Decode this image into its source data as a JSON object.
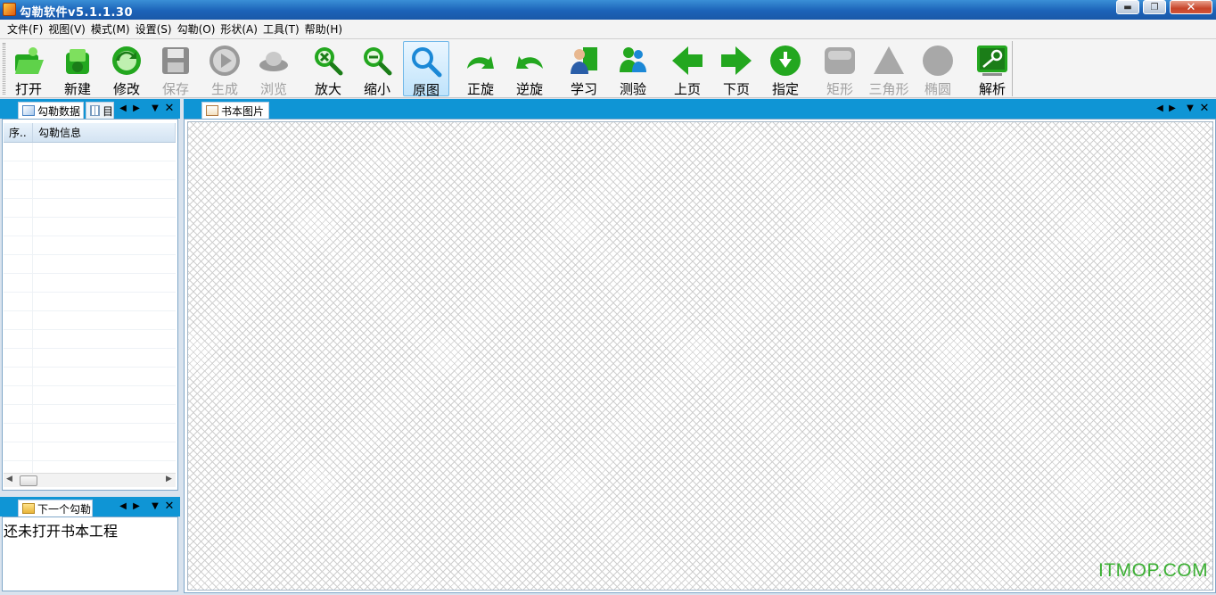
{
  "window": {
    "title": "勾勒软件v5.1.1.30"
  },
  "menu": [
    "文件(F)",
    "视图(V)",
    "模式(M)",
    "设置(S)",
    "勾勒(O)",
    "形状(A)",
    "工具(T)",
    "帮助(H)"
  ],
  "toolbar": [
    {
      "label": "打开",
      "icon": "folder-open-icon",
      "color": "#23a71f",
      "enabled": true
    },
    {
      "label": "新建",
      "icon": "new-file-icon",
      "color": "#23a71f",
      "enabled": true
    },
    {
      "label": "修改",
      "icon": "refresh-edit-icon",
      "color": "#23a71f",
      "enabled": true
    },
    {
      "label": "保存",
      "icon": "save-disk-icon",
      "color": "#8c8c8c",
      "enabled": false
    },
    {
      "label": "生成",
      "icon": "play-icon",
      "color": "#9a9a9a",
      "enabled": false
    },
    {
      "label": "浏览",
      "icon": "browse-icon",
      "color": "#9a9a9a",
      "enabled": false
    },
    {
      "label": "放大",
      "icon": "zoom-in-icon",
      "color": "#23a71f",
      "enabled": true
    },
    {
      "label": "缩小",
      "icon": "zoom-out-icon",
      "color": "#23a71f",
      "enabled": true
    },
    {
      "label": "原图",
      "icon": "original-size-icon",
      "color": "#1b88d6",
      "enabled": true,
      "active": true
    },
    {
      "label": "正旋",
      "icon": "rotate-cw-icon",
      "color": "#23a71f",
      "enabled": true
    },
    {
      "label": "逆旋",
      "icon": "rotate-ccw-icon",
      "color": "#23a71f",
      "enabled": true
    },
    {
      "label": "学习",
      "icon": "learn-user-icon",
      "color": "#23a71f",
      "enabled": true
    },
    {
      "label": "测验",
      "icon": "test-users-icon",
      "color": "#23a71f",
      "enabled": true
    },
    {
      "label": "上页",
      "icon": "arrow-left-icon",
      "color": "#23a71f",
      "enabled": true
    },
    {
      "label": "下页",
      "icon": "arrow-right-icon",
      "color": "#23a71f",
      "enabled": true
    },
    {
      "label": "指定",
      "icon": "arrow-down-circle-icon",
      "color": "#23a71f",
      "enabled": true
    },
    {
      "label": "矩形",
      "icon": "rectangle-icon",
      "color": "#a8a8a8",
      "enabled": false
    },
    {
      "label": "三角形",
      "icon": "triangle-icon",
      "color": "#a8a8a8",
      "enabled": false
    },
    {
      "label": "椭圆",
      "icon": "ellipse-icon",
      "color": "#a8a8a8",
      "enabled": false
    },
    {
      "label": "解析",
      "icon": "parse-key-icon",
      "color": "#23a71f",
      "enabled": true
    }
  ],
  "left_panel": {
    "tab_label": "勾勒数据",
    "second_tab_label": "目",
    "columns": [
      "序..",
      "勾勒信息"
    ]
  },
  "next_panel": {
    "tab_label": "下一个勾勒",
    "text": "还未打开书本工程"
  },
  "main_panel": {
    "tab_label": "书本图片"
  },
  "watermark": "ITMOP.COM",
  "colors": {
    "accent": "#0f95d5",
    "titlebar": "#1c63b8",
    "icon_green": "#23a71f",
    "watermark": "#3cb034"
  }
}
